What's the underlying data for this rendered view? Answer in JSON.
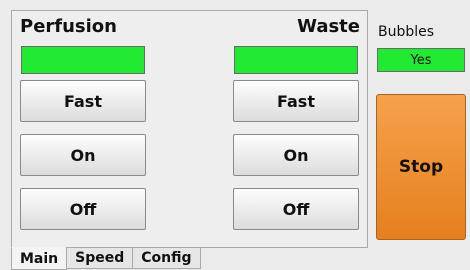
{
  "perfusion": {
    "title": "Perfusion",
    "status_color": "#22ea33",
    "buttons": [
      "Fast",
      "On",
      "Off"
    ]
  },
  "waste": {
    "title": "Waste",
    "status_color": "#22ea33",
    "buttons": [
      "Fast",
      "On",
      "Off"
    ]
  },
  "bubbles": {
    "label": "Bubbles",
    "value": "Yes",
    "color": "#22ea33"
  },
  "stop_button": {
    "label": "Stop",
    "color": "#f0902f"
  },
  "tabs": [
    {
      "label": "Main",
      "active": true
    },
    {
      "label": "Speed",
      "active": false
    },
    {
      "label": "Config",
      "active": false
    }
  ]
}
